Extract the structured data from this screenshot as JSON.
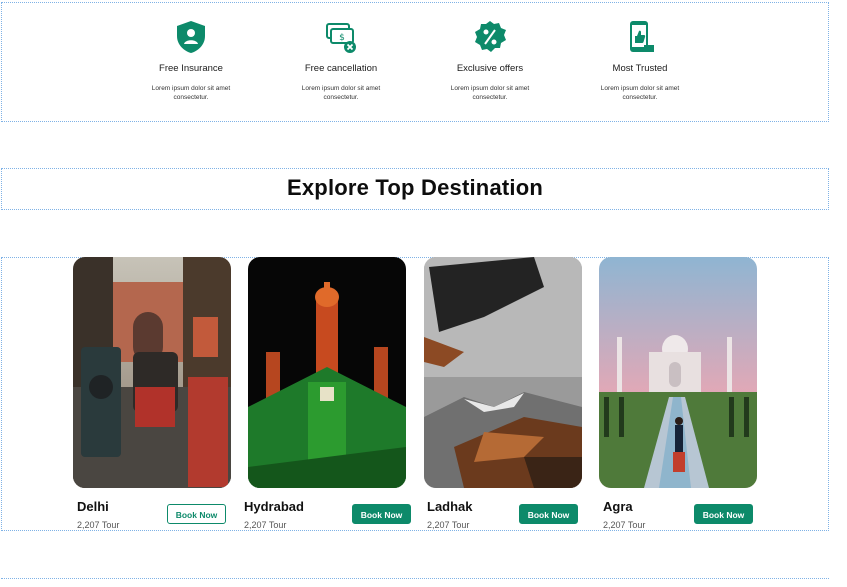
{
  "colors": {
    "accent": "#0d8a6a",
    "guide": "#7fb2e6"
  },
  "features": [
    {
      "icon": "shield-person-icon",
      "title": "Free Insurance",
      "desc": "Lorem ipsum dolor sit amet consectetur."
    },
    {
      "icon": "money-cancel-icon",
      "title": "Free cancellation",
      "desc": "Lorem ipsum dolor sit amet consectetur."
    },
    {
      "icon": "percent-badge-icon",
      "title": "Exclusive offers",
      "desc": "Lorem ipsum dolor sit amet consectetur."
    },
    {
      "icon": "phone-thumbs-up-icon",
      "title": "Most Trusted",
      "desc": "Lorem ipsum dolor sit amet consectetur."
    }
  ],
  "heading": "Explore Top Destination",
  "destinations": [
    {
      "name": "Delhi",
      "count": "2,207 Tour",
      "button": "Book Now",
      "button_style": "outline"
    },
    {
      "name": "Hydrabad",
      "count": "2,207 Tour",
      "button": "Book Now",
      "button_style": "filled"
    },
    {
      "name": "Ladhak",
      "count": "2,207 Tour",
      "button": "Book Now",
      "button_style": "filled"
    },
    {
      "name": "Agra",
      "count": "2,207 Tour",
      "button": "Book Now",
      "button_style": "filled"
    }
  ]
}
